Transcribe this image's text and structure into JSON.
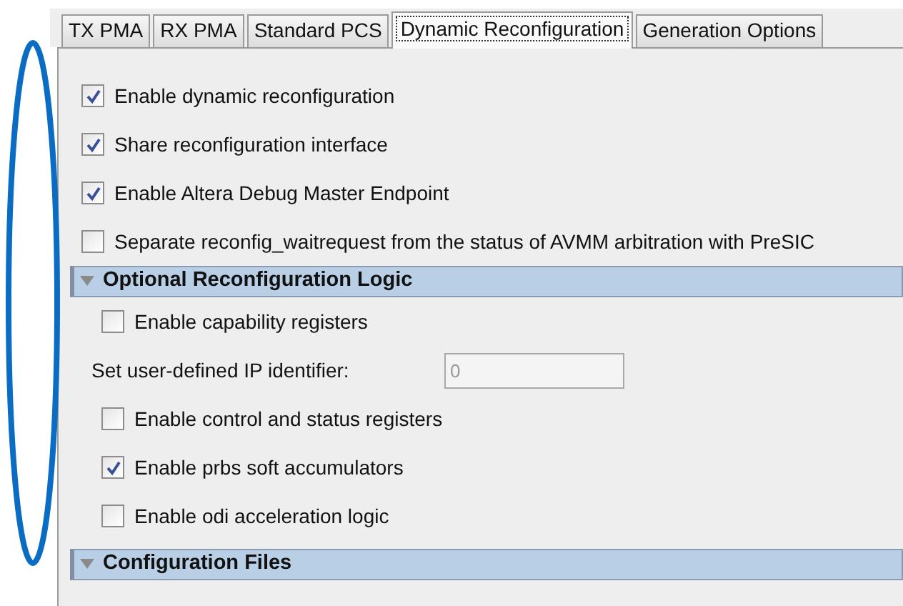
{
  "tabs": [
    {
      "label": "TX PMA",
      "selected": false
    },
    {
      "label": "RX PMA",
      "selected": false
    },
    {
      "label": "Standard PCS",
      "selected": false
    },
    {
      "label": "Dynamic Reconfiguration",
      "selected": true
    },
    {
      "label": "Generation Options",
      "selected": false
    }
  ],
  "options": [
    {
      "label": "Enable dynamic reconfiguration",
      "checked": true
    },
    {
      "label": "Share reconfiguration interface",
      "checked": true
    },
    {
      "label": "Enable Altera Debug Master Endpoint",
      "checked": true
    },
    {
      "label": "Separate reconfig_waitrequest from the status of AVMM arbitration with PreSIC",
      "checked": false
    }
  ],
  "sections": [
    {
      "title": "Optional Reconfiguration Logic",
      "expanded": true,
      "items": [
        {
          "kind": "checkbox",
          "label": "Enable capability registers",
          "checked": false
        },
        {
          "kind": "field",
          "label": "Set user-defined IP identifier:",
          "value": "0",
          "disabled": true
        },
        {
          "kind": "checkbox",
          "label": "Enable control and status registers",
          "checked": false
        },
        {
          "kind": "checkbox",
          "label": "Enable prbs soft accumulators",
          "checked": true
        },
        {
          "kind": "checkbox",
          "label": "Enable odi acceleration logic",
          "checked": false
        }
      ]
    },
    {
      "title": "Configuration Files",
      "expanded": true
    }
  ],
  "annotation": {
    "kind": "ellipse",
    "color": "#0b6cc4"
  }
}
